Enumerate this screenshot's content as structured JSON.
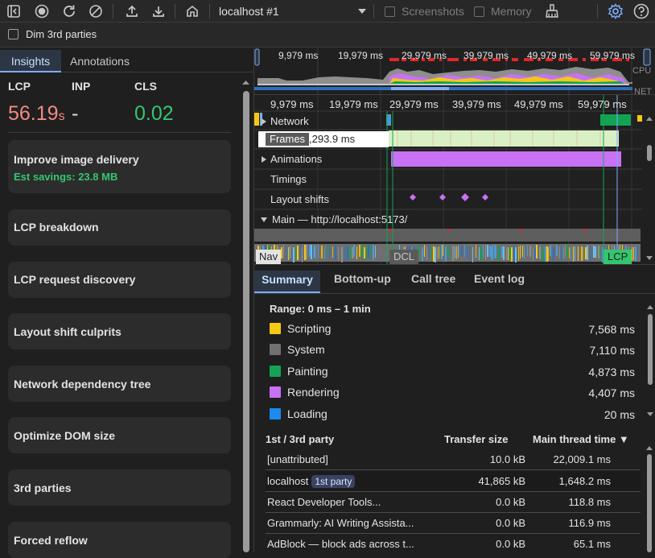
{
  "toolbar": {
    "target": "localhost #1",
    "screenshots_label": "Screenshots",
    "memory_label": "Memory",
    "dim_3rd_parties_label": "Dim 3rd parties"
  },
  "left_panel": {
    "tabs": [
      "Insights",
      "Annotations"
    ],
    "metrics": {
      "lcp": {
        "label": "LCP",
        "value": "56.19",
        "unit": "s"
      },
      "inp": {
        "label": "INP",
        "value": "-"
      },
      "cls": {
        "label": "CLS",
        "value": "0.02"
      }
    },
    "insights": [
      {
        "title": "Improve image delivery",
        "savings": "Est savings: 23.8 MB"
      },
      {
        "title": "LCP breakdown"
      },
      {
        "title": "LCP request discovery"
      },
      {
        "title": "Layout shift culprits"
      },
      {
        "title": "Network dependency tree"
      },
      {
        "title": "Optimize DOM size"
      },
      {
        "title": "3rd parties"
      },
      {
        "title": "Forced reflow"
      }
    ]
  },
  "overview": {
    "ticks": [
      "9,979 ms",
      "19,979 ms",
      "29,979 ms",
      "39,979 ms",
      "49,979 ms",
      "59,979 ms"
    ],
    "cpu_label": "CPU",
    "net_label": "NET"
  },
  "timeline": {
    "ticks": [
      "9,979 ms",
      "19,979 ms",
      "29,979 ms",
      "39,979 ms",
      "49,979 ms",
      "59,979 ms"
    ],
    "tracks": {
      "network": "Network",
      "frames": "Frames",
      "frames_value": ",293.9 ms",
      "animations": "Animations",
      "timings": "Timings",
      "layout_shifts": "Layout shifts",
      "main": "Main — http://localhost:5173/"
    },
    "markers": {
      "nav": "Nav",
      "dcl": "DCL",
      "lcp": "LCP"
    }
  },
  "bottom_panel": {
    "tabs": [
      "Summary",
      "Bottom-up",
      "Call tree",
      "Event log"
    ],
    "range": "Range: 0 ms – 1 min",
    "categories": [
      {
        "name": "Scripting",
        "value": "7,568 ms",
        "color": "#f5c814"
      },
      {
        "name": "System",
        "value": "7,110 ms",
        "color": "#707070"
      },
      {
        "name": "Painting",
        "value": "4,873 ms",
        "color": "#12a453"
      },
      {
        "name": "Rendering",
        "value": "4,407 ms",
        "color": "#c971f5"
      },
      {
        "name": "Loading",
        "value": "20 ms",
        "color": "#1a8cf0"
      }
    ],
    "third_party_table": {
      "headers": [
        "1st / 3rd party",
        "Transfer size",
        "Main thread time ▼"
      ],
      "rows": [
        {
          "name": "[unattributed]",
          "badge": "",
          "transfer": "10.0 kB",
          "main": "22,009.1 ms"
        },
        {
          "name": "localhost",
          "badge": "1st party",
          "transfer": "41,865 kB",
          "main": "1,648.2 ms"
        },
        {
          "name": "React Developer Tools...",
          "badge": "",
          "transfer": "0.0 kB",
          "main": "118.8 ms"
        },
        {
          "name": "Grammarly: AI Writing Assista...",
          "badge": "",
          "transfer": "0.0 kB",
          "main": "116.9 ms"
        },
        {
          "name": "AdBlock — block ads across t...",
          "badge": "",
          "transfer": "0.0 kB",
          "main": "65.1 ms"
        }
      ]
    }
  }
}
